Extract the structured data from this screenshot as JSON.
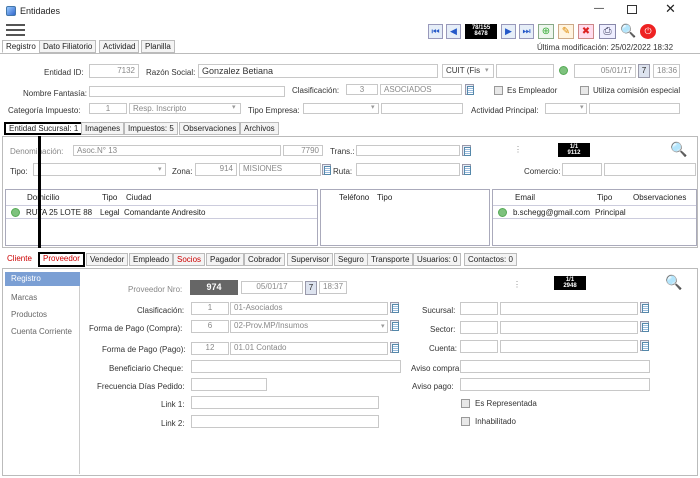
{
  "window": {
    "title": "Entidades"
  },
  "toolbar": {
    "counter_top": "78/155",
    "counter_bottom": "8478"
  },
  "last_modified": "Última modificación: 25/02/2022 18:32",
  "main_tabs": [
    "Registro",
    "Dato Filiatorio",
    "Actividad",
    "Planilla"
  ],
  "form": {
    "entidad_id_label": "Entidad ID:",
    "entidad_id": "7132",
    "razon_social_label": "Razón Social:",
    "razon_social": "Gonzalez Betiana",
    "cuit_type": "CUIT (Fis",
    "date": "05/01/17",
    "date_btn": "7",
    "time": "18:36",
    "nombre_fantasia_label": "Nombre Fantasía:",
    "clasificacion_label": "Clasificación:",
    "clasificacion_code": "3",
    "clasificacion": "ASOCIADOS",
    "es_empleador": "Es Empleador",
    "utiliza_comision": "Utiliza comisión especial",
    "categoria_label": "Categoría Impuesto:",
    "categoria_code": "1",
    "categoria": "Resp. Inscripto",
    "tipo_empresa_label": "Tipo Empresa:",
    "actividad_label": "Actividad Principal:"
  },
  "sub_tabs": [
    "Entidad Sucursal: 1",
    "Imagenes",
    "Impuestos: 5",
    "Observaciones",
    "Archivos"
  ],
  "sucursal": {
    "denominacion_label": "Denominación:",
    "denominacion": "Asoc.N° 13",
    "den_code": "7790",
    "trans_label": "Trans.:",
    "counter_top": "1/1",
    "counter_bottom": "9112",
    "tipo_label": "Tipo:",
    "zona_label": "Zona:",
    "zona_code": "914",
    "zona": "MISIONES",
    "ruta_label": "Ruta:",
    "comercio_label": "Comercio:"
  },
  "address_table": {
    "headers": [
      "Domicilio",
      "Tipo",
      "Ciudad"
    ],
    "row": [
      "RUTA 25 LOTE 88",
      "Legal",
      "Comandante Andresito"
    ]
  },
  "phone_table": {
    "headers": [
      "Teléfono",
      "Tipo"
    ]
  },
  "email_table": {
    "headers": [
      "Email",
      "Tipo",
      "Observaciones"
    ],
    "row": [
      "b.schegg@gmail.com",
      "Principal",
      ""
    ]
  },
  "role_tabs": [
    "Cliente",
    "Proveedor",
    "Vendedor",
    "Empleado",
    "Socios",
    "Pagador",
    "Cobrador",
    "Supervisor",
    "Seguro",
    "Transporte",
    "Usuarios: 0",
    "Contactos: 0"
  ],
  "side_menu": [
    "Registro",
    "Marcas",
    "Productos",
    "Cuenta Corriente"
  ],
  "proveedor": {
    "nro_label": "Proveedor Nro:",
    "nro": "974",
    "date": "05/01/17",
    "date_btn": "7",
    "time": "18:37",
    "counter_top": "1/1",
    "counter_bottom": "2948",
    "clasif_label": "Clasificación:",
    "clasif_code": "1",
    "clasif": "01-Asociados",
    "forma_compra_label": "Forma de Pago (Compra):",
    "forma_compra_code": "6",
    "forma_compra": "02-Prov.MP/Insumos",
    "forma_pago_label": "Forma de Pago (Pago):",
    "forma_pago_code": "12",
    "forma_pago": "01.01 Contado",
    "beneficiario_label": "Beneficiario Cheque:",
    "frecuencia_label": "Frecuencia Días Pedido:",
    "link1_label": "Link 1:",
    "link2_label": "Link 2:",
    "sucursal_label": "Sucursal:",
    "sector_label": "Sector:",
    "cuenta_label": "Cuenta:",
    "aviso_compra_label": "Aviso compra:",
    "aviso_pago_label": "Aviso pago:",
    "es_representada": "Es Representada",
    "inhabilitado": "Inhabilitado"
  }
}
